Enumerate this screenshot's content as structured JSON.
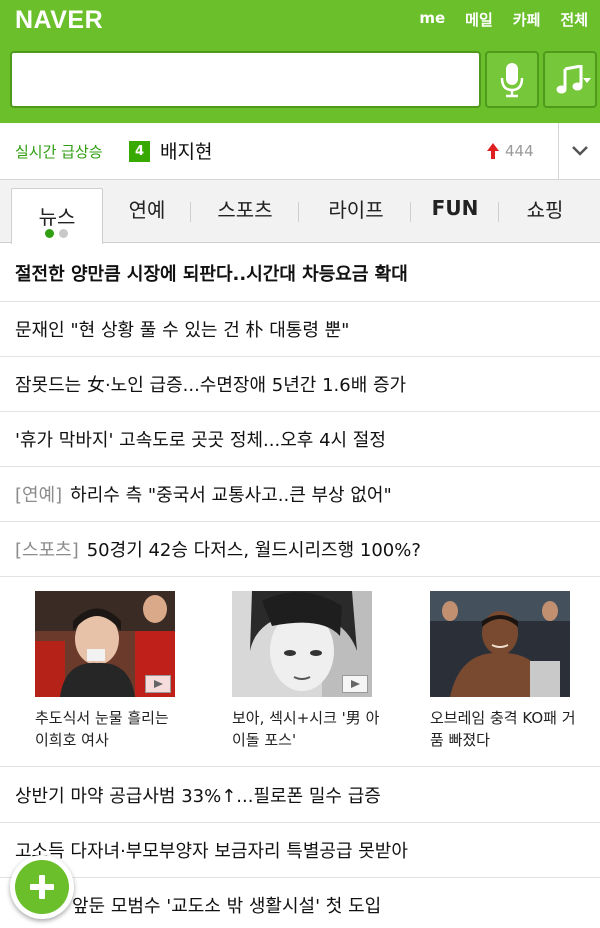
{
  "header": {
    "logo": "NAVER",
    "nav": [
      "me",
      "메일",
      "카페",
      "전체"
    ],
    "search": {
      "value": "",
      "placeholder": ""
    },
    "mic_icon": "microphone-icon",
    "music_icon": "music-note-icon",
    "brand_color": "#6abf2b"
  },
  "trending": {
    "label": "실시간 급상승",
    "rank": "4",
    "keyword": "배지현",
    "count": "444",
    "trend_icon": "up-arrow-icon",
    "toggle_icon": "chevron-down-icon"
  },
  "tabs": {
    "items": [
      "뉴스",
      "연예",
      "스포츠",
      "라이프",
      "FUN",
      "쇼핑"
    ],
    "active": "뉴스",
    "page_dots": {
      "count": 2,
      "active_index": 0
    }
  },
  "headlines": [
    {
      "text": "절전한 양만큼 시장에 되판다..시간대 차등요금 확대",
      "category": ""
    },
    {
      "text": "문재인 \"현 상황 풀 수 있는 건 朴 대통령 뿐\"",
      "category": ""
    },
    {
      "text": "잠못드는 女·노인 급증...수면장애 5년간 1.6배 증가",
      "category": ""
    },
    {
      "text": "'휴가 막바지' 고속도로 곳곳 정체...오후 4시 절정",
      "category": ""
    },
    {
      "text": "하리수 측 \"중국서 교통사고..큰 부상 없어\"",
      "category": "[연예]"
    },
    {
      "text": "50경기 42승 다저스, 월드시리즈행 100%?",
      "category": "[스포츠]"
    }
  ],
  "photo_news": [
    {
      "caption": "추도식서 눈물 흘리는 이희호 여사",
      "play_icon": "video-play-icon"
    },
    {
      "caption": "보아, 섹시+시크 '男 아이돌 포스'",
      "play_icon": "video-play-icon"
    },
    {
      "caption": "오브레임 충격 KO패 거품 빠졌다",
      "play_icon": ""
    }
  ],
  "more_headlines": [
    "상반기 마약 공급사범 33%↑...필로폰 밀수 급증",
    "고소득 다자녀·부모부양자 보금자리 특별공급 못받아",
    "앞둔 모범수 '교도소 밖 생활시설' 첫 도입"
  ],
  "fab": {
    "icon": "plus-icon"
  }
}
